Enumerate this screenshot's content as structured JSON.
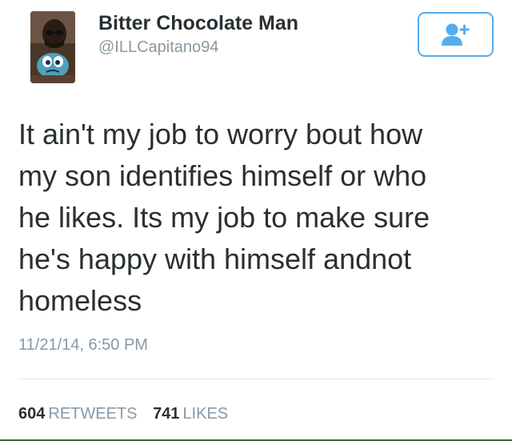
{
  "user": {
    "name": "Bitter Chocolate Man",
    "handle": "@ILLCapitano94",
    "avatar_icon": "profile-photo"
  },
  "follow_button": {
    "icon": "add-user-icon",
    "color": "#55acee"
  },
  "tweet": {
    "lines": [
      "It ain't my job to worry bout how",
      "my son identifies himself or who",
      "he likes. Its my job to make sure",
      "he's happy with himself andnot",
      "homeless"
    ],
    "timestamp": "11/21/14, 6:50 PM"
  },
  "stats": {
    "retweets_count": "604",
    "retweets_label": "RETWEETS",
    "likes_count": "741",
    "likes_label": "LIKES"
  },
  "colors": {
    "text": "#292f33",
    "muted": "#8899a6",
    "accent": "#55acee",
    "divider": "#e1e8ed"
  }
}
